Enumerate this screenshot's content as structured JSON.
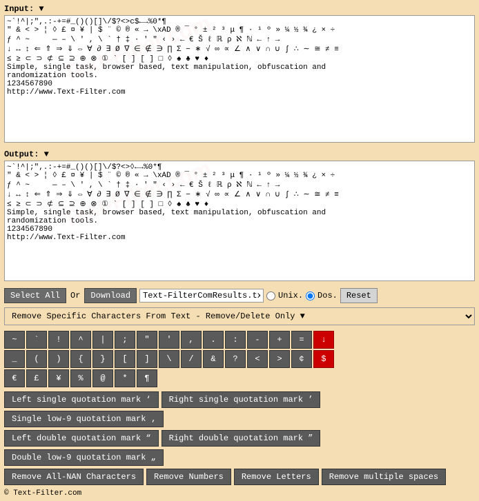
{
  "input": {
    "label": "Input: ▼",
    "content": "~`!^|;\",.:-+=#_()()[]\\/$?<>c$←→%0*¶\n\" & < > ¦ ◊ £ ¤ ¥ | $ ¨ © ® « → \\xAD ® ¯ ° ± ² ³ μ ¶ · ¹ º » ¼ ½ ¾ ¿ × ÷\nƒ ^ ~     — – \\ ' , \\ ` † ‡ · ' \" ‹ › ← € Š ℓ ℝ ρ ℵ ℕ ← ↑ →\n↓ ↔ ↕ ⇐ ⇑ ⇒ ⇓ ⇔ ∀ ∂ ∃ Ø ∇ ∈ ∉ ∋ ∏ Σ − ∗ √ ∞ ∝ ∠ ∧ ∨ ∩ ∪ ∫ ∴ ∼ ≅ ≠ ≡\n≤ ≥ ⊂ ⊃ ⊄ ⊆ ⊇ ⊕ ⊗ ① ` [ ] [ ] □ ◊ ♠ ♣ ♥ ♦\nSimple, single task, browser based, text manipulation, obfuscation and\nrandomization tools.\n1234567890\nhttp://www.Text-Filter.com"
  },
  "output": {
    "label": "Output: ▼",
    "content": "~`!^|;\",.:-+=#_()()[]\\/$?<>◊←→%0*¶\n\" & < > ¦ ◊ £ ¤ ¥ | $ ¨ © ® « → \\xAD ® ¯ ° ± ² ³ μ ¶ · ¹ º » ¼ ½ ¾ ¿ × ÷\nƒ ^ ~     — – \\ ' , \\ ` † ‡ · ' \" ‹ › ← € Š ℓ ℝ ρ ℵ ℕ ← ↑ →\n↓ ↔ ↕ ⇐ ⇑ ⇒ ⇓ ⇔ ∀ ∂ ∃ Ø ∇ ∈ ∉ ∋ ∏ Σ − ∗ √ ∞ ∝ ∠ ∧ ∨ ∩ ∪ ∫ ∴ ∼ ≅ ≠ ≡\n≤ ≥ ⊂ ⊃ ⊄ ⊆ ⊇ ⊕ ⊗ ① ` [ ] [ ] □ ◊ ♠ ♣ ♥ ♦\nSimple, single task, browser based, text manipulation, obfuscation and\nrandomization tools.\n1234567890\nhttp://www.Text-Filter.com"
  },
  "toolbar": {
    "select_all": "Select All",
    "or": "Or",
    "download": "Download",
    "filename": "Text-FilterComResults.txt",
    "unix_label": "Unix.",
    "dos_label": "Dos.",
    "reset": "Reset"
  },
  "filter_select": {
    "label": "Remove Specific Characters From Text - Remove/Delete Only ▼"
  },
  "char_rows": {
    "row1": [
      "~",
      "`",
      "!",
      "^",
      "|",
      ";",
      "\"",
      "'",
      ",",
      ".",
      ":",
      "-",
      "+",
      "="
    ],
    "row2": [
      "_",
      "(",
      ")",
      "{",
      "}",
      "[",
      "]",
      "\\",
      "/",
      "&",
      "?",
      "<",
      ">",
      "¢",
      "$"
    ],
    "row3": [
      "€",
      "£",
      "¥",
      "%",
      "@",
      "*",
      "¶"
    ]
  },
  "wide_buttons": {
    "row1": [
      "Left single quotation mark ‘",
      "Right single quotation mark ’",
      "Single low-9 quotation mark ‚"
    ],
    "row2": [
      "Left double quotation mark “",
      "Right double quotation mark ”",
      "Double low-9 quotation mark „"
    ],
    "row3": [
      "Remove All-NAN Characters",
      "Remove Numbers",
      "Remove Letters",
      "Remove multiple spaces"
    ]
  },
  "footer": {
    "text": "© Text-Filter.com"
  },
  "watermark": "Text-Filter.com"
}
